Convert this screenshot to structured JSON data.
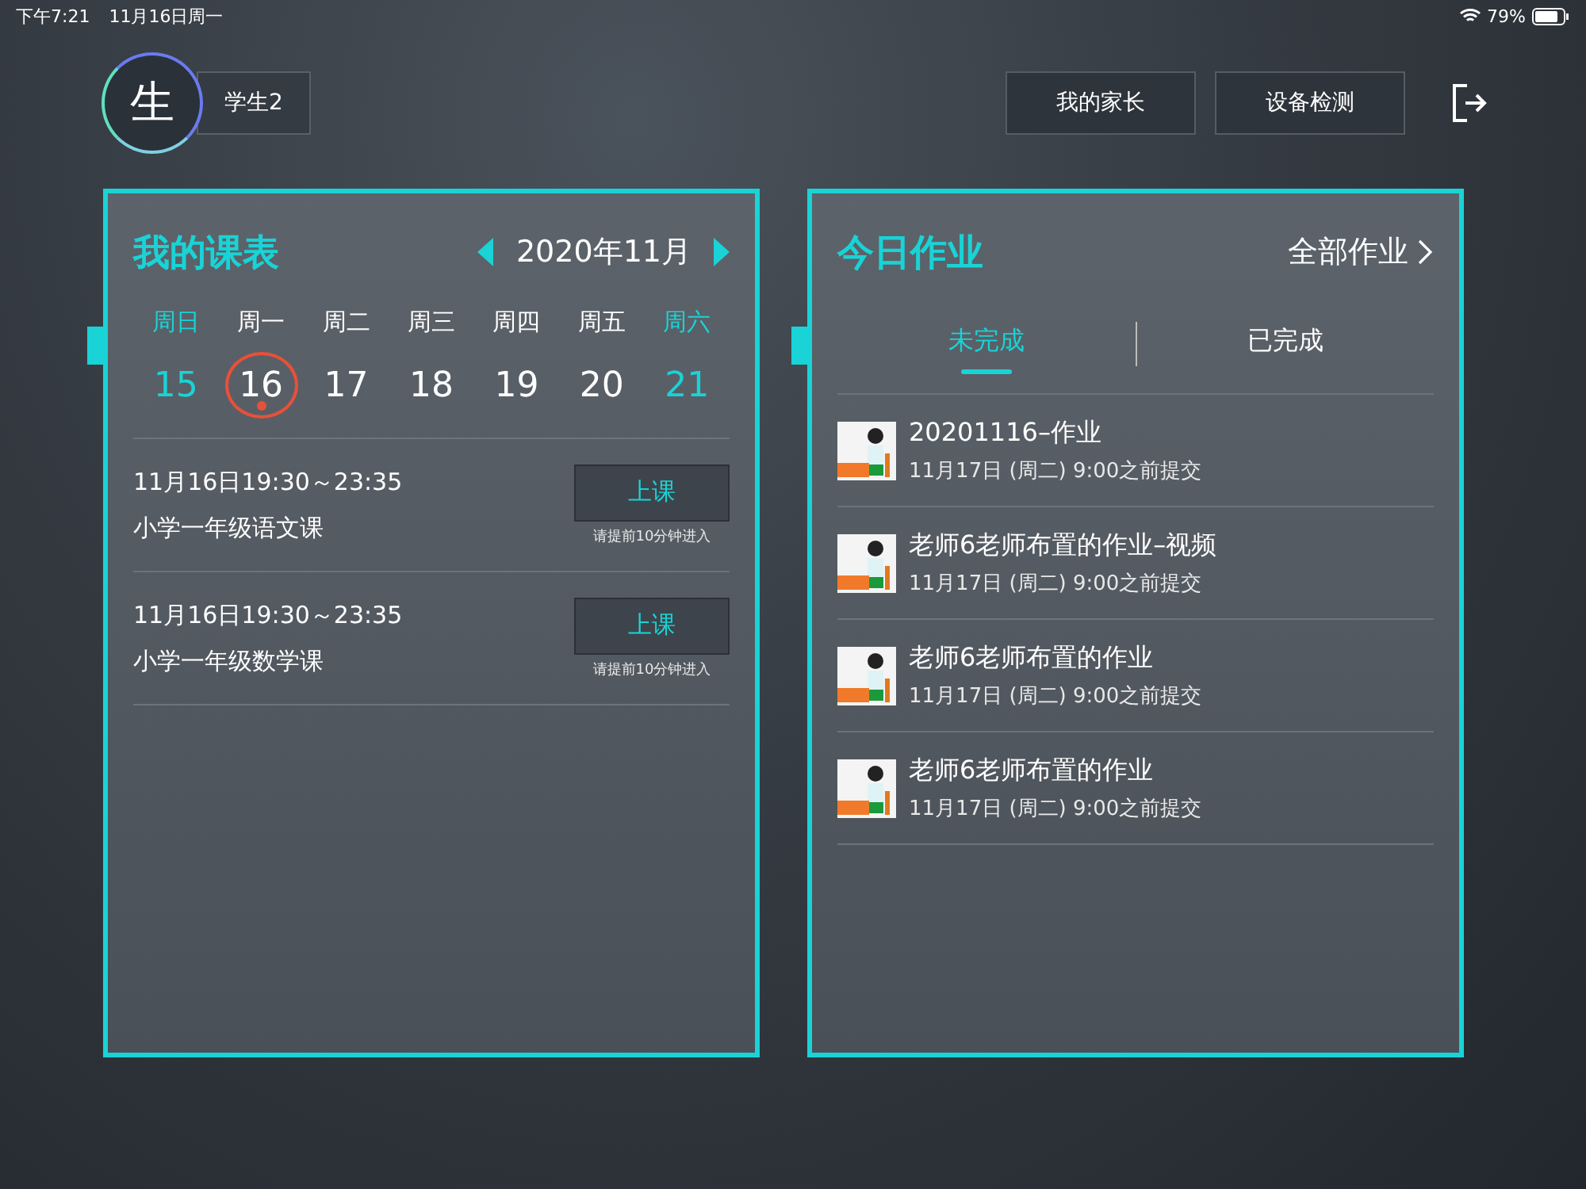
{
  "status_bar": {
    "time": "下午7:21",
    "date": "11月16日周一",
    "battery": "79%"
  },
  "header": {
    "avatar": "生",
    "name": "学生2",
    "buttons": [
      "我的家长",
      "设备检测"
    ]
  },
  "schedule": {
    "title": "我的课表",
    "month": "2020年11月",
    "days": [
      {
        "weekday": "周日",
        "date": "15",
        "weekend": true,
        "selected": false
      },
      {
        "weekday": "周一",
        "date": "16",
        "weekend": false,
        "selected": true
      },
      {
        "weekday": "周二",
        "date": "17",
        "weekend": false,
        "selected": false
      },
      {
        "weekday": "周三",
        "date": "18",
        "weekend": false,
        "selected": false
      },
      {
        "weekday": "周四",
        "date": "19",
        "weekend": false,
        "selected": false
      },
      {
        "weekday": "周五",
        "date": "20",
        "weekend": false,
        "selected": false
      },
      {
        "weekday": "周六",
        "date": "21",
        "weekend": true,
        "selected": false
      }
    ],
    "lessons": [
      {
        "time": "11月16日19:30～23:35",
        "name": "小学一年级语文课",
        "button": "上课",
        "hint": "请提前10分钟进入"
      },
      {
        "time": "11月16日19:30～23:35",
        "name": "小学一年级数学课",
        "button": "上课",
        "hint": "请提前10分钟进入"
      }
    ]
  },
  "homework": {
    "title": "今日作业",
    "all_link": "全部作业",
    "tabs": [
      {
        "label": "未完成",
        "selected": true
      },
      {
        "label": "已完成",
        "selected": false
      }
    ],
    "items": [
      {
        "title": "20201116–作业",
        "deadline": "11月17日 (周二) 9:00之前提交"
      },
      {
        "title": "老师6老师布置的作业–视频",
        "deadline": "11月17日 (周二) 9:00之前提交"
      },
      {
        "title": "老师6老师布置的作业",
        "deadline": "11月17日 (周二) 9:00之前提交"
      },
      {
        "title": "老师6老师布置的作业",
        "deadline": "11月17日 (周二) 9:00之前提交"
      }
    ]
  }
}
